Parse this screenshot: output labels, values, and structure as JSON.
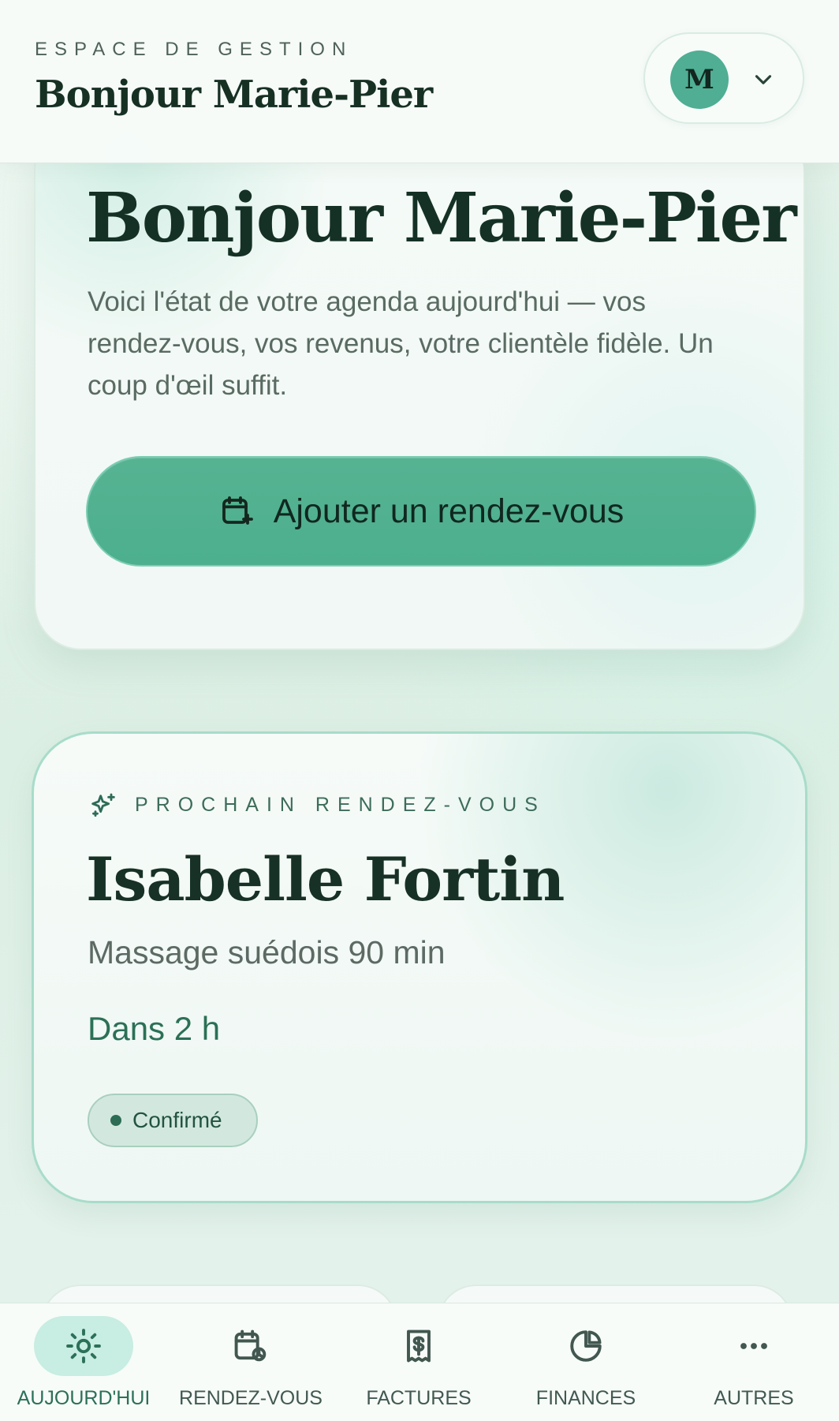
{
  "header": {
    "eyebrow": "ESPACE DE GESTION",
    "title": "Bonjour Marie-Pier",
    "avatar_initial": "M",
    "icons": {
      "dropdown": "chevron-down-icon"
    }
  },
  "hero": {
    "title": "Bonjour Marie-Pier",
    "description": "Voici l'état de votre agenda aujourd'hui — vos rendez-vous, vos revenus, votre clientèle fidèle. Un coup d'œil suffit.",
    "button_label": "Ajouter un rendez-vous",
    "button_icon": "calendar-plus-icon"
  },
  "next_appointment": {
    "eyebrow": "PROCHAIN RENDEZ-VOUS",
    "client_name": "Isabelle Fortin",
    "service": "Massage suédois 90 min",
    "eta": "Dans 2 h",
    "status": "Confirmé",
    "icon": "sparkle-icon"
  },
  "bottom_nav": {
    "items": [
      {
        "label": "AUJOURD'HUI",
        "icon": "sun-icon",
        "active": true
      },
      {
        "label": "RENDEZ-VOUS",
        "icon": "calendar-clock-icon",
        "active": false
      },
      {
        "label": "FACTURES",
        "icon": "receipt-dollar-icon",
        "active": false
      },
      {
        "label": "FINANCES",
        "icon": "pie-chart-icon",
        "active": false
      },
      {
        "label": "AUTRES",
        "icon": "more-horizontal-icon",
        "active": false
      }
    ]
  },
  "theme": {
    "accent": "#4caf8e",
    "accent_border": "#7ccdb3",
    "text_dark": "#173126",
    "text_muted": "#596b62",
    "active_nav": "#2c7058",
    "badge_bg": "#d2e8de"
  }
}
